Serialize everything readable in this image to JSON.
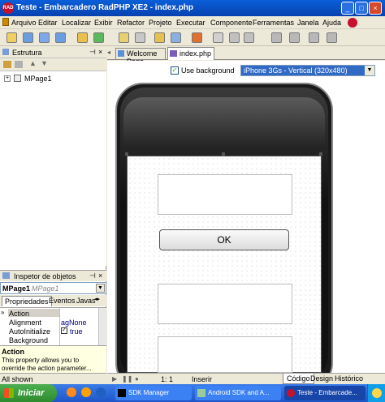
{
  "window": {
    "title": "Teste - Embarcadero RadPHP XE2 - index.php",
    "app_icon_text": "RAD"
  },
  "menu": [
    "Arquivo",
    "Editar",
    "Localizar",
    "Exibir",
    "Refactor",
    "Projeto",
    "Executar",
    "Componente",
    "Ferramentas",
    "Janela",
    "Ajuda"
  ],
  "left": {
    "estrutura_title": "Estrutura",
    "tree_root": "MPage1",
    "inspector_title": "Inspetor de objetos",
    "inspector_selected_name": "MPage1",
    "inspector_selected_class": "MPage1",
    "tabs": [
      "Propriedades",
      "Eventos",
      "Javas"
    ],
    "props": [
      {
        "name": "Action",
        "value": ""
      },
      {
        "name": "Alignment",
        "value": "agNone"
      },
      {
        "name": "AutoInitialize",
        "value": "true"
      },
      {
        "name": "Background",
        "value": ""
      }
    ],
    "help_title": "Action",
    "help_text": "This property allows you to override the action parameter...",
    "status": "All shown"
  },
  "editor": {
    "tabs": [
      "Welcome Page",
      "index.php"
    ],
    "use_background_label": "Use background",
    "use_background_checked": true,
    "device": "iPhone 3Gs - Vertical (320x480)",
    "ok_label": "OK",
    "status_pos": "1:  1",
    "status_mode": "Inserir",
    "bottom_tabs": [
      "Código",
      "Design",
      "Histórico"
    ]
  },
  "taskbar": {
    "start": "Iniciar",
    "tasks": [
      "SDK Manager",
      "Android SDK and A...",
      "Teste - Embarcade..."
    ]
  }
}
